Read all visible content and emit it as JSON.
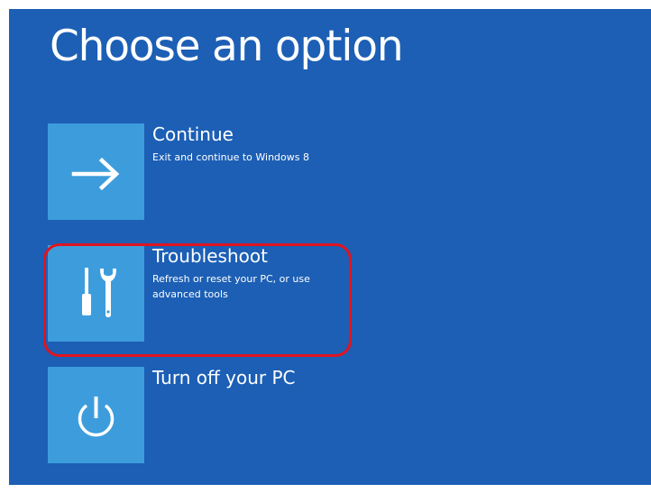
{
  "screen": {
    "title": "Choose an option",
    "options": [
      {
        "title": "Continue",
        "description": "Exit and continue to Windows 8",
        "icon": "arrow-right-icon"
      },
      {
        "title": "Troubleshoot",
        "description": "Refresh or reset your PC, or use advanced tools",
        "icon": "tools-icon"
      },
      {
        "title": "Turn off your PC",
        "description": "",
        "icon": "power-icon"
      }
    ]
  },
  "colors": {
    "background": "#1c5fb5",
    "tile": "#3d9ddc",
    "highlight": "#e0141f",
    "text": "#ffffff"
  }
}
